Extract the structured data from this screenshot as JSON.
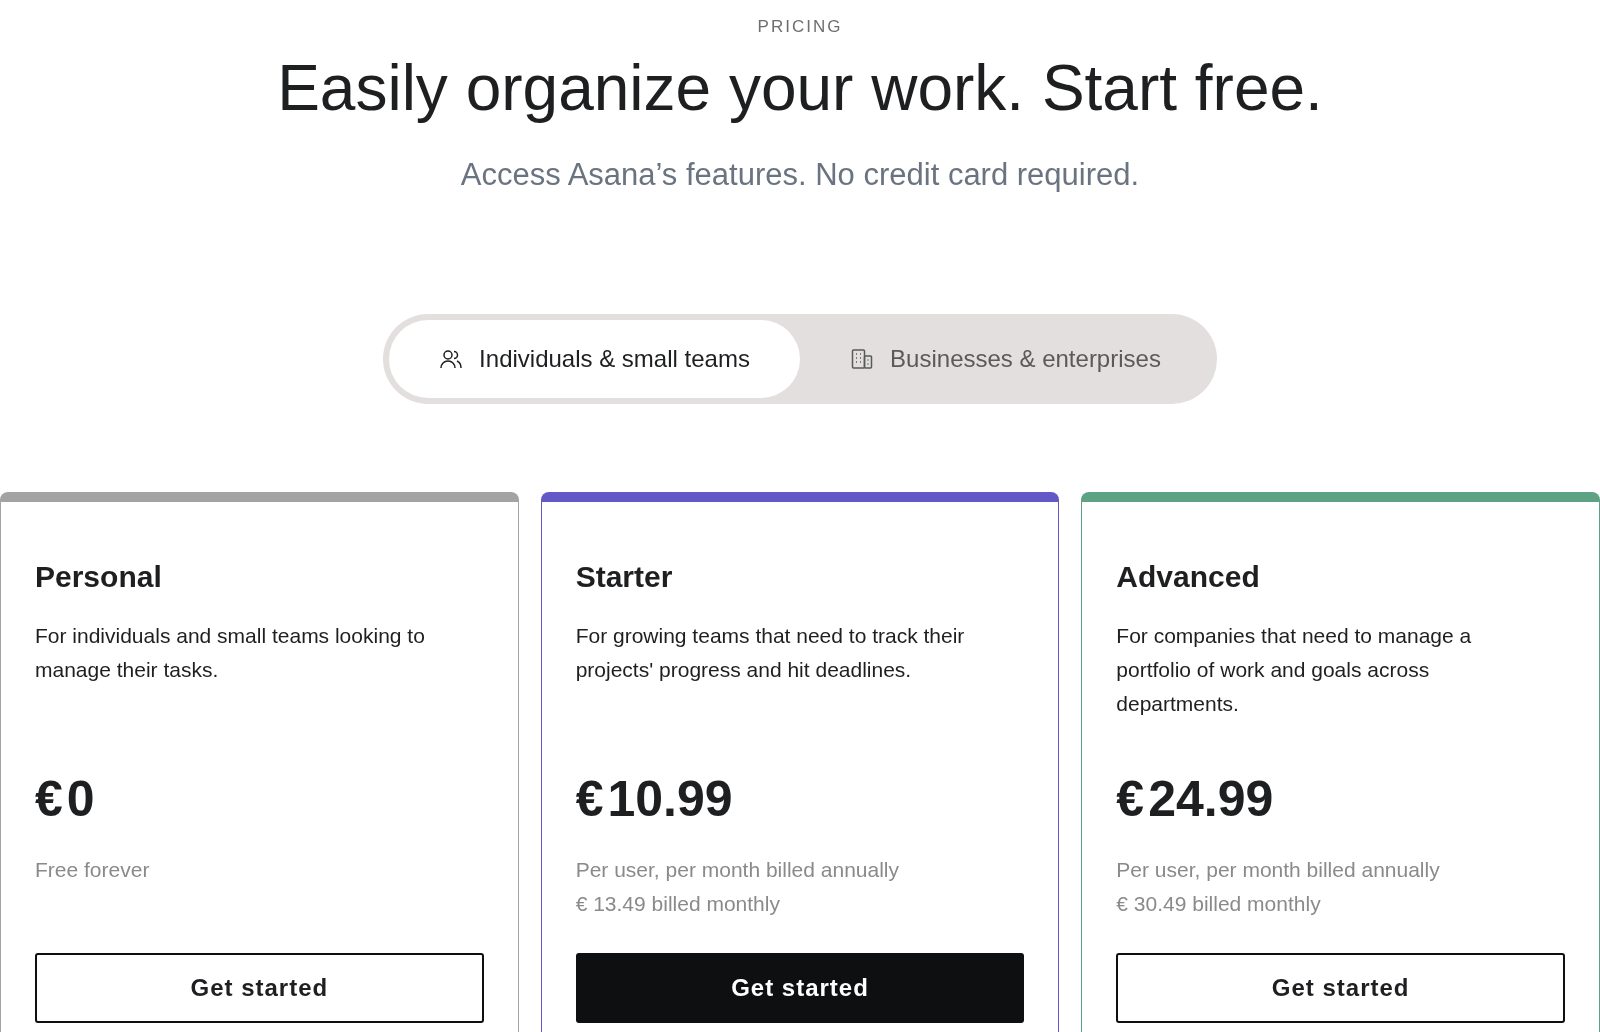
{
  "eyebrow": "PRICING",
  "heading": "Easily organize your work. Start free.",
  "subheading": "Access Asana’s features. No credit card required.",
  "segments": [
    {
      "label": "Individuals & small teams",
      "selected": true
    },
    {
      "label": "Businesses & enterprises",
      "selected": false
    }
  ],
  "plans": [
    {
      "name": "Personal",
      "color": "#a3a3a3",
      "description": "For individuals and small teams looking to manage their tasks.",
      "currency": "€",
      "amount": "0",
      "notes": [
        "Free forever"
      ],
      "button": {
        "label": "Get started",
        "primary": false
      }
    },
    {
      "name": "Starter",
      "color": "#6457c6",
      "description": "For growing teams that need to track their projects' progress and hit deadlines.",
      "currency": "€",
      "amount": "10.99",
      "notes": [
        "Per user, per month billed annually",
        "€ 13.49 billed monthly"
      ],
      "button": {
        "label": "Get started",
        "primary": true
      }
    },
    {
      "name": "Advanced",
      "color": "#5da283",
      "description": "For companies that need to manage a portfolio of work and goals across departments.",
      "currency": "€",
      "amount": "24.99",
      "notes": [
        "Per user, per month billed annually",
        "€ 30.49 billed monthly"
      ],
      "button": {
        "label": "Get started",
        "primary": false
      }
    }
  ]
}
